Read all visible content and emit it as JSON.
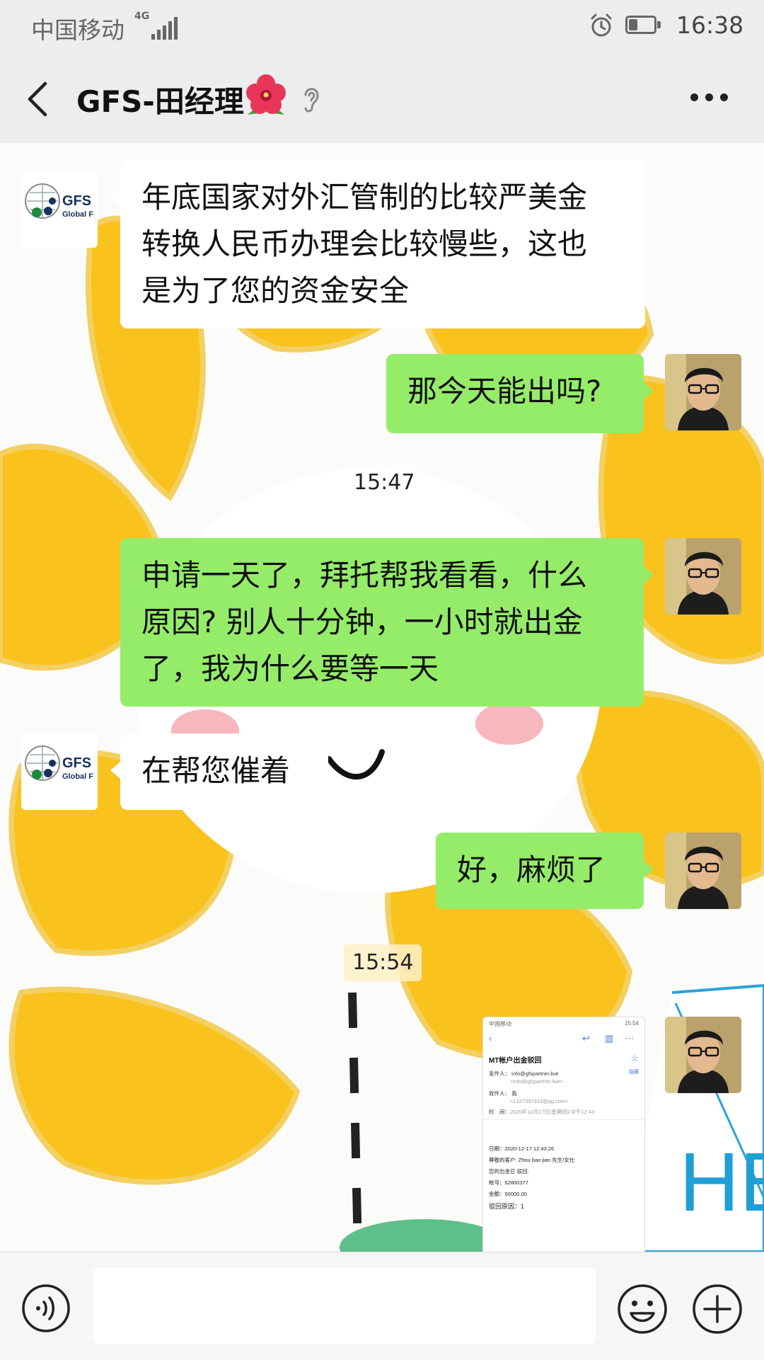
{
  "status_bar": {
    "carrier": "中国移动",
    "network": "4G",
    "time": "16:38",
    "icons": [
      "signal-icon",
      "alarm-icon",
      "battery-icon"
    ]
  },
  "header": {
    "title": "GFS-田经理",
    "title_emoji": "hibiscus",
    "icons": [
      "back-icon",
      "earpiece-icon",
      "more-icon"
    ]
  },
  "contact_avatar": {
    "text_main": "GFS",
    "text_sub": "Global F"
  },
  "messages": [
    {
      "side": "in",
      "lines": [
        "年底国家对外汇管制的比较严美金",
        "转换人民币办理会比较慢些，这也",
        "是为了您的资金安全"
      ]
    },
    {
      "side": "out",
      "lines": [
        "那今天能出吗?"
      ]
    },
    {
      "side": "in",
      "lines": [
        "在帮您催着"
      ]
    },
    {
      "side": "out",
      "lines": [
        "好，麻烦了"
      ]
    }
  ],
  "timestamps": [
    "15:47",
    "15:54"
  ],
  "long_message": {
    "side": "out",
    "lines": [
      "申请一天了，拜托帮我看看，什么",
      "原因? 别人十分钟，一小时就出金",
      "了，我为什么要等一天"
    ]
  },
  "email_screenshot": {
    "status_left": "中国移动",
    "status_right": "15:54",
    "subject": "MT帐户出金驳回",
    "from_label": "发件人：",
    "from": "info@gfspartner.live",
    "from_addr": "<info@gfspartner.live>",
    "hide_link": "隐藏",
    "to_label": "收件人：",
    "to": "我",
    "to_addr": "<1327397313@qq.com>",
    "time_label": "时　间：",
    "time": "2020年12月17日(星期四) 中午12:43",
    "body": [
      "日期：2020-12-17 12:43:26",
      "尊敬的客户: Zhou bao jian 先生/女仕",
      "您的出金已 驳回:",
      "帐号：62800377",
      "金额：50000.00",
      "驳回原因：1"
    ]
  },
  "background_text": "HE",
  "input_bar": {
    "placeholder": "",
    "icons": [
      "voice-icon",
      "emoji-icon",
      "add-icon"
    ]
  }
}
